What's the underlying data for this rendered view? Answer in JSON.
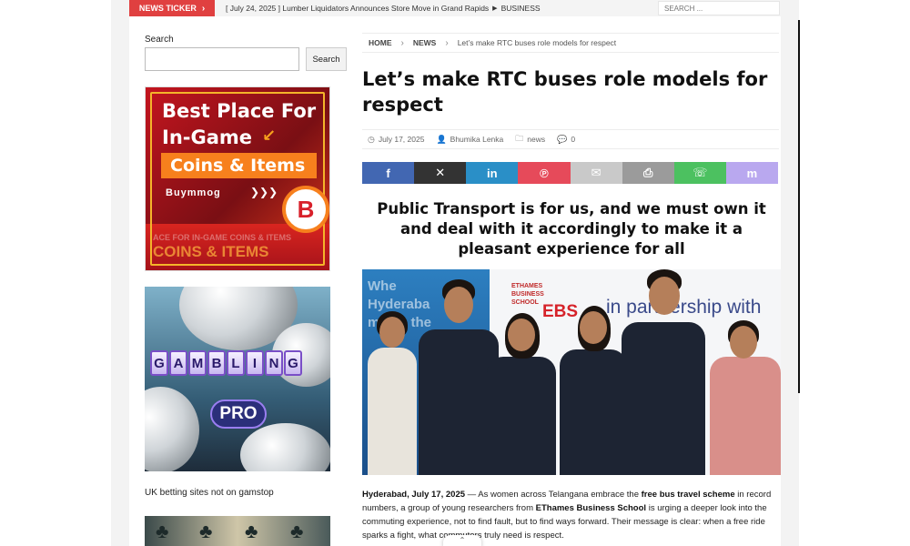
{
  "ticker": {
    "label": "NEWS TICKER",
    "headline": "[ July 24, 2025 ]  Lumber Liquidators Announces Store Move in Grand Rapids",
    "category": "BUSINESS",
    "search_placeholder": "SEARCH ..."
  },
  "sidebar": {
    "search_label": "Search",
    "search_button": "Search",
    "ad1": {
      "lines": [
        "Best Place For",
        "In-Game"
      ],
      "highlight": "Coins & Items",
      "brand": "Buymmog",
      "logo_letter": "B",
      "bottom_line": "ACE FOR IN-GAME COINS & ITEMS",
      "bottom_coins": "COINS & ITEMS"
    },
    "ad2": {
      "letters": [
        "G",
        "A",
        "M",
        "B",
        "L",
        "I",
        "N",
        "G"
      ],
      "badge": "PRO"
    },
    "link_text": "UK betting sites not on gamstop"
  },
  "breadcrumb": {
    "home": "HOME",
    "section": "NEWS",
    "current": "Let’s make RTC buses role models for respect"
  },
  "article": {
    "title": "Let’s make RTC buses role models for respect",
    "date": "July 17, 2025",
    "author": "Bhumika Lenka",
    "category": "news",
    "comments": "0",
    "subtitle": "Public Transport is for us, and we must own it and deal with it accordingly to make it a pleasant experience for all",
    "photo": {
      "banner_lines": [
        "Whe",
        "Hyderaba",
        "meets the"
      ],
      "school_small": "ETHAMES BUSINESS SCHOOL",
      "ebs": "EBS",
      "partnership": "in partnership with"
    },
    "body": {
      "dateline": "Hyderabad, July 17, 2025",
      "part1": " — As women across Telangana embrace the ",
      "bold1": "free bus travel scheme",
      "part2": " in record numbers, a group of young researchers from ",
      "bold2": "EThames Business School",
      "part3": " is urging a deeper look into the commuting experience, not to find fault, but to find ways forward. Their message is clear: when a free ride sparks a fight, what commuters truly need is respect."
    }
  },
  "share": {
    "buttons": [
      {
        "name": "facebook",
        "glyph": "f",
        "color": "#4267b2"
      },
      {
        "name": "x",
        "glyph": "✕",
        "color": "#333333"
      },
      {
        "name": "linkedin",
        "glyph": "in",
        "color": "#2a8fc7"
      },
      {
        "name": "pinterest",
        "glyph": "℗",
        "color": "#e64a5a"
      },
      {
        "name": "email",
        "glyph": "✉",
        "color": "#c9c9c9"
      },
      {
        "name": "print",
        "glyph": "⎙",
        "color": "#9b9b9b"
      },
      {
        "name": "whatsapp",
        "glyph": "☏",
        "color": "#4cc160"
      },
      {
        "name": "mastodon",
        "glyph": "m",
        "color": "#b9a8ef"
      }
    ]
  },
  "colors": {
    "accent_red": "#e04040",
    "ticker_bg": "#f4f4f4"
  }
}
